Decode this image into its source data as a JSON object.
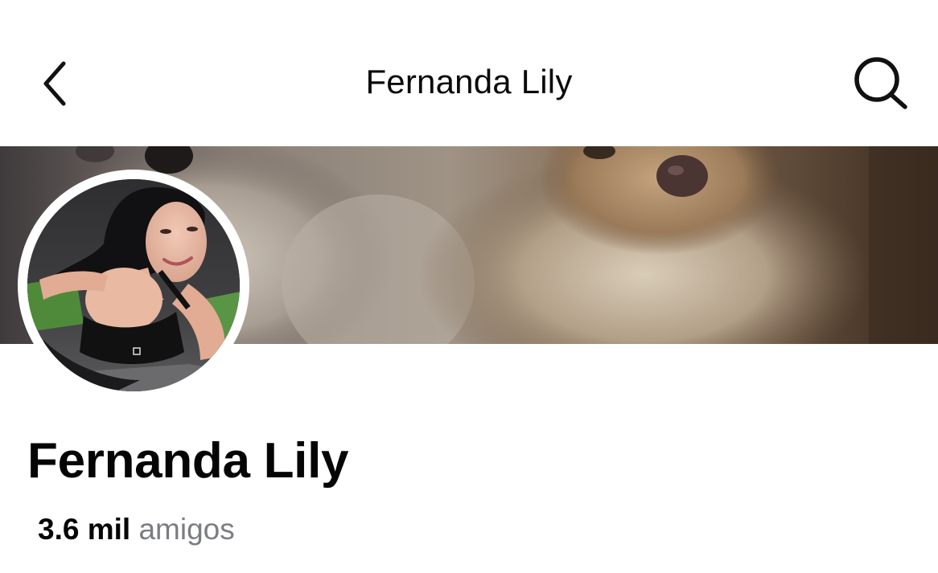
{
  "header": {
    "title": "Fernanda Lily",
    "back_icon": "chevron-left-icon",
    "search_icon": "search-icon"
  },
  "cover": {
    "description_icon": "cover-photo"
  },
  "profile": {
    "name": "Fernanda Lily",
    "friends_count": "3.6 mil",
    "friends_label": "amigos"
  },
  "colors": {
    "text_primary": "#050505",
    "text_secondary": "#7b7d82",
    "background": "#ffffff"
  }
}
